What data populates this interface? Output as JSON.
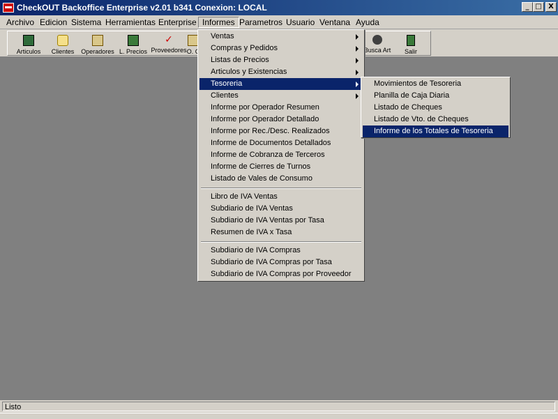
{
  "window": {
    "title": "CheckOUT Backoffice Enterprise v2.01 b341 Conexion: LOCAL",
    "minimize": "_",
    "maximize": "□",
    "close": "X"
  },
  "menubar": [
    "Archivo",
    "Edicion",
    "Sistema",
    "Herramientas",
    "Enterprise",
    "Informes",
    "Parametros",
    "Usuario",
    "Ventana",
    "Ayuda"
  ],
  "toolbar": {
    "articulos": "Articulos",
    "clientes": "Clientes",
    "operadores": "Operadores",
    "lprecios": "L. Precios",
    "proveedores": "Proveedores",
    "oc": "O. C",
    "buscar": "Busca Art",
    "salir": "Salir"
  },
  "informes_menu": [
    "Ventas",
    "Compras y Pedidos",
    "Listas de Precios",
    "Articulos y Existencias",
    "Tesoreria",
    "Clientes",
    "Informe por Operador Resumen",
    "Informe por Operador Detallado",
    "Informe por Rec./Desc. Realizados",
    "Informe de Documentos Detallados",
    "Informe de Cobranza de Terceros",
    "Informe de Cierres de Turnos",
    "Listado de Vales de Consumo",
    "Libro de IVA Ventas",
    "Subdiario de IVA Ventas",
    "Subdiario de IVA Ventas por Tasa",
    "Resumen de IVA x Tasa",
    "Subdiario de IVA Compras",
    "Subdiario de IVA Compras por Tasa",
    "Subdiario de IVA Compras por Proveedor"
  ],
  "tesoreria_submenu": [
    "Movimientos de Tesoreria",
    "Planilla de Caja Diaria",
    "Listado de Cheques",
    "Listado de Vto. de Cheques",
    "Informe de los Totales de Tesoreria"
  ],
  "status": {
    "text": "Listo"
  }
}
